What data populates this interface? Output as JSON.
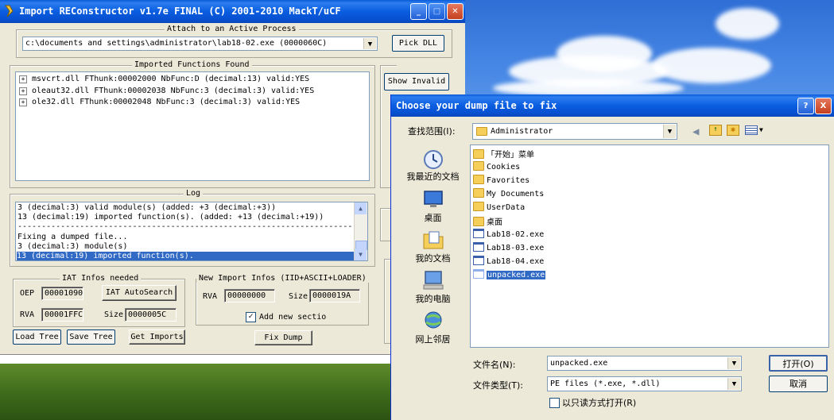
{
  "colors": {
    "xp_blue": "#0a5ee0",
    "selection": "#316ac5",
    "window_bg": "#ece9d8"
  },
  "main_window": {
    "title": "Import REConstructor v1.7e FINAL (C) 2001-2010 MackT/uCF",
    "attach_group_label": "Attach to an Active Process",
    "process_value": "c:\\documents and settings\\administrator\\lab18-02.exe (0000060C)",
    "pick_dll_label": "Pick DLL",
    "imports_group_label": "Imported Functions Found",
    "imports": [
      "msvcrt.dll FThunk:00002000 NbFunc:D (decimal:13) valid:YES",
      "oleaut32.dll FThunk:00002038 NbFunc:3 (decimal:3) valid:YES",
      "ole32.dll FThunk:00002048 NbFunc:3 (decimal:3) valid:YES"
    ],
    "show_invalid_label": "Show Invalid",
    "log_group_label": "Log",
    "log_lines": [
      "3 (decimal:3) valid module(s) (added: +3 (decimal:+3))",
      "13 (decimal:19) imported function(s). (added: +13 (decimal:+19))",
      "--------------------------------------------------------------------------",
      "Fixing a dumped file...",
      "3 (decimal:3) module(s)",
      "13 (decimal:19) imported function(s)."
    ],
    "iat_group_label": "IAT Infos needed",
    "oep_label": "OEP",
    "oep_value": "00001090",
    "iat_autosearch_label": "IAT AutoSearch",
    "rva_label": "RVA",
    "rva_value": "00001FFC",
    "size_label": "Size",
    "size_value": "0000005C",
    "new_import_group_label": "New Import Infos (IID+ASCII+LOADER)",
    "new_rva_value": "00000000",
    "new_size_value": "0000019A",
    "add_section_label": "Add new sectio",
    "load_tree_label": "Load Tree",
    "save_tree_label": "Save Tree",
    "get_imports_label": "Get Imports",
    "fix_dump_label": "Fix Dump"
  },
  "dialog": {
    "title": "Choose your dump file to fix",
    "help_label": "?",
    "close_label": "X",
    "look_in_label": "查找范围(I):",
    "look_in_value": "Administrator",
    "places": [
      "我最近的文档",
      "桌面",
      "我的文档",
      "我的电脑",
      "网上邻居"
    ],
    "files": [
      {
        "name": "「开始」菜单",
        "type": "folder"
      },
      {
        "name": "Cookies",
        "type": "folder"
      },
      {
        "name": "Favorites",
        "type": "folder"
      },
      {
        "name": "My Documents",
        "type": "folder"
      },
      {
        "name": "UserData",
        "type": "folder"
      },
      {
        "name": "桌面",
        "type": "folder"
      },
      {
        "name": "Lab18-02.exe",
        "type": "exe"
      },
      {
        "name": "Lab18-03.exe",
        "type": "exe"
      },
      {
        "name": "Lab18-04.exe",
        "type": "exe"
      },
      {
        "name": "unpacked.exe",
        "type": "exe",
        "selected": true
      }
    ],
    "filename_label": "文件名(N):",
    "filename_value": "unpacked.exe",
    "filetype_label": "文件类型(T):",
    "filetype_value": "PE files (*.exe, *.dll)",
    "readonly_label": "以只读方式打开(R)",
    "open_label": "打开(O)",
    "cancel_label": "取消"
  }
}
